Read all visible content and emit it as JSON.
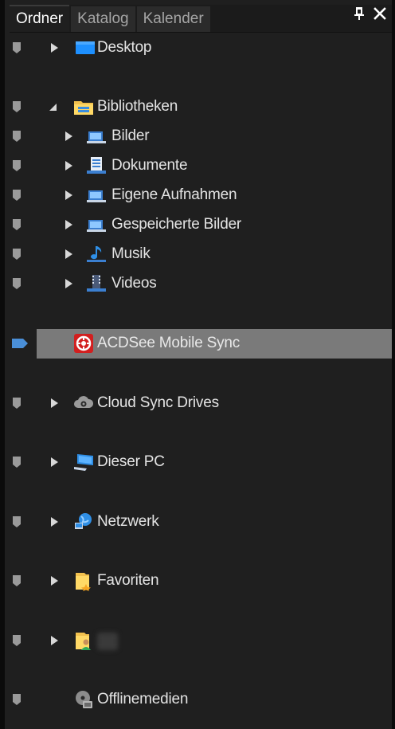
{
  "tabs": [
    {
      "label": "Ordner",
      "active": true
    },
    {
      "label": "Katalog",
      "active": false
    },
    {
      "label": "Kalender",
      "active": false
    }
  ],
  "controls": {
    "pin_glyph": "ᵽ",
    "close_glyph": "✕"
  },
  "tree": {
    "items": [
      {
        "label": "Desktop",
        "icon": "desktop-icon",
        "expander": "collapsed"
      },
      {
        "label": "Bibliotheken",
        "icon": "library-folder-icon",
        "expander": "expanded"
      },
      {
        "label": "Bilder",
        "icon": "pictures-library-icon",
        "expander": "collapsed"
      },
      {
        "label": "Dokumente",
        "icon": "documents-library-icon",
        "expander": "collapsed"
      },
      {
        "label": "Eigene Aufnahmen",
        "icon": "recordings-library-icon",
        "expander": "collapsed"
      },
      {
        "label": "Gespeicherte Bilder",
        "icon": "saved-pictures-library-icon",
        "expander": "collapsed"
      },
      {
        "label": "Musik",
        "icon": "music-library-icon",
        "expander": "collapsed"
      },
      {
        "label": "Videos",
        "icon": "videos-library-icon",
        "expander": "collapsed"
      },
      {
        "label": "ACDSee Mobile Sync",
        "icon": "acdsee-mobile-sync-icon",
        "expander": "none",
        "selected": true
      },
      {
        "label": "Cloud Sync Drives",
        "icon": "cloud-drive-icon",
        "expander": "collapsed"
      },
      {
        "label": "Dieser PC",
        "icon": "this-pc-icon",
        "expander": "collapsed"
      },
      {
        "label": "Netzwerk",
        "icon": "network-icon",
        "expander": "collapsed"
      },
      {
        "label": "Favoriten",
        "icon": "favorites-folder-icon",
        "expander": "collapsed"
      },
      {
        "label": "",
        "icon": "user-folder-icon",
        "expander": "collapsed"
      },
      {
        "label": "Offlinemedien",
        "icon": "offline-media-icon",
        "expander": "none"
      }
    ]
  },
  "colors": {
    "background": "#1f1f1f",
    "selection": "#7a7a7a",
    "pin": "#9a9a9a",
    "pin_selected": "#4a8fd8",
    "text": "#e4e4e4"
  }
}
